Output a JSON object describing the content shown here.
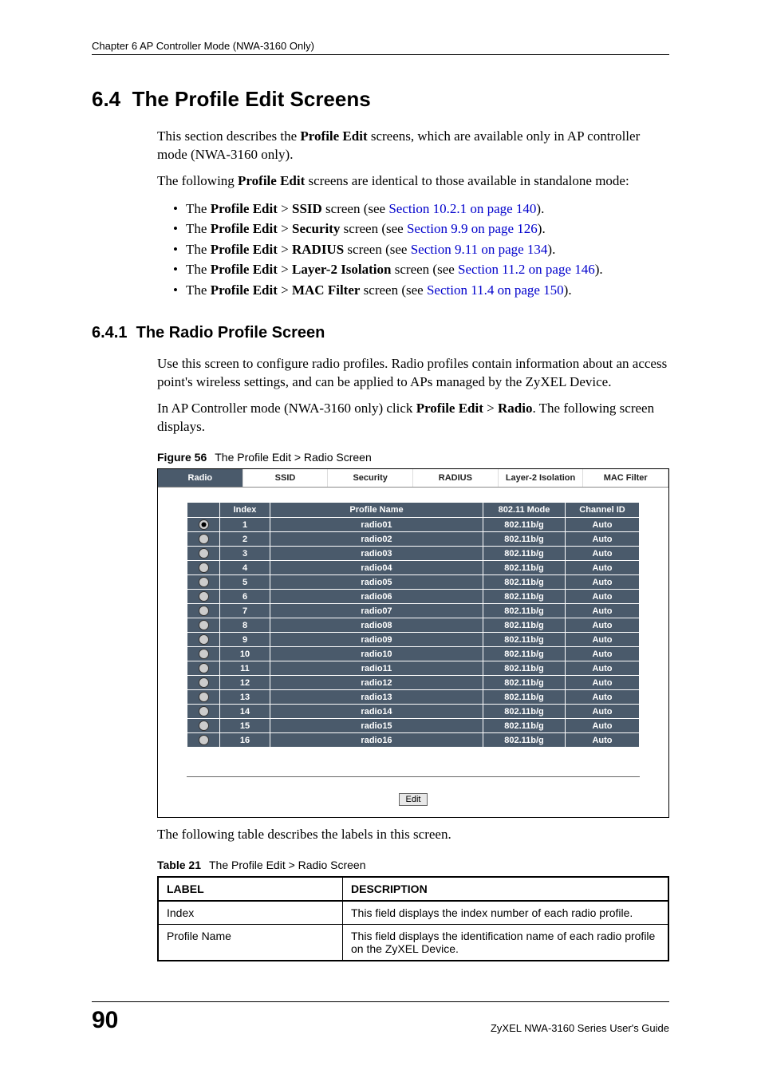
{
  "header": {
    "running": "Chapter 6 AP Controller Mode (NWA-3160 Only)"
  },
  "section": {
    "number": "6.4",
    "title": "The Profile Edit Screens",
    "intro1_a": "This section describes the ",
    "intro1_b": "Profile Edit",
    "intro1_c": " screens, which are available only in AP controller mode (NWA-3160 only).",
    "intro2_a": "The following ",
    "intro2_b": "Profile Edit",
    "intro2_c": " screens are identical to those available in standalone mode:",
    "bullets": [
      {
        "pre": "The ",
        "b1": "Profile Edit",
        "sep": " > ",
        "b2": "SSID",
        "post": " screen (see ",
        "xref": "Section 10.2.1 on page 140",
        "tail": ")."
      },
      {
        "pre": "The ",
        "b1": "Profile Edit",
        "sep": " > ",
        "b2": "Security",
        "post": " screen (see ",
        "xref": "Section 9.9 on page 126",
        "tail": ")."
      },
      {
        "pre": "The ",
        "b1": "Profile Edit",
        "sep": " > ",
        "b2": "RADIUS",
        "post": " screen (see ",
        "xref": "Section 9.11 on page 134",
        "tail": ")."
      },
      {
        "pre": "The ",
        "b1": "Profile Edit",
        "sep": " > ",
        "b2": "Layer-2 Isolation",
        "post": " screen (see ",
        "xref": "Section 11.2 on page 146",
        "tail": ")."
      },
      {
        "pre": "The ",
        "b1": "Profile Edit",
        "sep": " > ",
        "b2": "MAC Filter",
        "post": " screen (see ",
        "xref": "Section 11.4 on page 150",
        "tail": ")."
      }
    ]
  },
  "subsection": {
    "number": "6.4.1",
    "title": "The Radio Profile Screen",
    "p1": "Use this screen to configure radio profiles. Radio profiles contain information about an access point's wireless settings, and can be applied to APs managed by the ZyXEL Device.",
    "p2_a": "In AP Controller mode (NWA-3160 only) click ",
    "p2_b1": "Profile Edit",
    "p2_sep": " > ",
    "p2_b2": "Radio",
    "p2_c": ". The following screen displays."
  },
  "figure": {
    "label": "Figure 56",
    "caption": "The Profile Edit > Radio Screen",
    "tabs": [
      "Radio",
      "SSID",
      "Security",
      "RADIUS",
      "Layer-2 Isolation",
      "MAC Filter"
    ],
    "active_tab": 0,
    "headers": {
      "index": "Index",
      "profile": "Profile Name",
      "mode": "802.11 Mode",
      "channel": "Channel ID"
    },
    "rows": [
      {
        "selected": true,
        "index": "1",
        "name": "radio01",
        "mode": "802.11b/g",
        "channel": "Auto"
      },
      {
        "selected": false,
        "index": "2",
        "name": "radio02",
        "mode": "802.11b/g",
        "channel": "Auto"
      },
      {
        "selected": false,
        "index": "3",
        "name": "radio03",
        "mode": "802.11b/g",
        "channel": "Auto"
      },
      {
        "selected": false,
        "index": "4",
        "name": "radio04",
        "mode": "802.11b/g",
        "channel": "Auto"
      },
      {
        "selected": false,
        "index": "5",
        "name": "radio05",
        "mode": "802.11b/g",
        "channel": "Auto"
      },
      {
        "selected": false,
        "index": "6",
        "name": "radio06",
        "mode": "802.11b/g",
        "channel": "Auto"
      },
      {
        "selected": false,
        "index": "7",
        "name": "radio07",
        "mode": "802.11b/g",
        "channel": "Auto"
      },
      {
        "selected": false,
        "index": "8",
        "name": "radio08",
        "mode": "802.11b/g",
        "channel": "Auto"
      },
      {
        "selected": false,
        "index": "9",
        "name": "radio09",
        "mode": "802.11b/g",
        "channel": "Auto"
      },
      {
        "selected": false,
        "index": "10",
        "name": "radio10",
        "mode": "802.11b/g",
        "channel": "Auto"
      },
      {
        "selected": false,
        "index": "11",
        "name": "radio11",
        "mode": "802.11b/g",
        "channel": "Auto"
      },
      {
        "selected": false,
        "index": "12",
        "name": "radio12",
        "mode": "802.11b/g",
        "channel": "Auto"
      },
      {
        "selected": false,
        "index": "13",
        "name": "radio13",
        "mode": "802.11b/g",
        "channel": "Auto"
      },
      {
        "selected": false,
        "index": "14",
        "name": "radio14",
        "mode": "802.11b/g",
        "channel": "Auto"
      },
      {
        "selected": false,
        "index": "15",
        "name": "radio15",
        "mode": "802.11b/g",
        "channel": "Auto"
      },
      {
        "selected": false,
        "index": "16",
        "name": "radio16",
        "mode": "802.11b/g",
        "channel": "Auto"
      }
    ],
    "edit_button": "Edit"
  },
  "aftertable_text": "The following table describes the labels in this screen.",
  "desc_table": {
    "label": "Table 21",
    "caption": "The Profile Edit > Radio Screen",
    "headers": {
      "label": "LABEL",
      "desc": "DESCRIPTION"
    },
    "rows": [
      {
        "label": "Index",
        "desc": "This field displays the index number of each radio profile."
      },
      {
        "label": "Profile Name",
        "desc": "This field displays the identification name of each radio profile on the ZyXEL Device."
      }
    ]
  },
  "footer": {
    "page": "90",
    "guide": "ZyXEL NWA-3160 Series User's Guide"
  }
}
